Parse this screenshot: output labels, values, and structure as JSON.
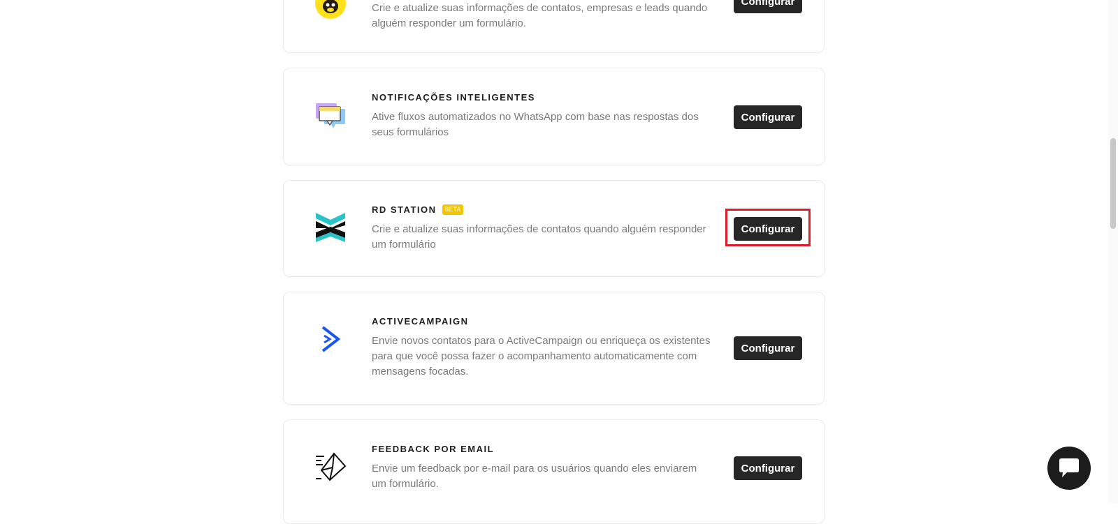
{
  "integrations": [
    {
      "title": "",
      "badge": "",
      "description": "Crie e atualize suas informações de contatos, empresas e leads quando alguém responder um formulário.",
      "button_label": "Configurar",
      "logo_icon": "mailchimp-icon"
    },
    {
      "title": "NOTIFICAÇÕES INTELIGENTES",
      "badge": "",
      "description": "Ative fluxos automatizados no WhatsApp com base nas respostas dos seus formulários",
      "button_label": "Configurar",
      "logo_icon": "chat-bubbles-icon"
    },
    {
      "title": "RD STATION",
      "badge": "BETA",
      "description": "Crie e atualize suas informações de contatos quando alguém responder um formulário",
      "button_label": "Configurar",
      "logo_icon": "rd-station-icon"
    },
    {
      "title": "ACTIVECAMPAIGN",
      "badge": "",
      "description": "Envie novos contatos para o ActiveCampaign ou enriqueça os existentes para que você possa fazer o acompanhamento automaticamente com mensagens focadas.",
      "button_label": "Configurar",
      "logo_icon": "activecampaign-icon"
    },
    {
      "title": "FEEDBACK POR EMAIL",
      "badge": "",
      "description": "Envie um feedback por e-mail para os usuários quando eles enviarem um formulário.",
      "button_label": "Configurar",
      "logo_icon": "email-send-icon"
    }
  ],
  "chat_widget": {
    "icon": "chat-icon"
  },
  "colors": {
    "button_bg": "#262626",
    "highlight": "#e0192b",
    "badge": "#f5c400",
    "rd_teal": "#2ac3c9",
    "activecampaign_blue": "#1a56f0"
  }
}
